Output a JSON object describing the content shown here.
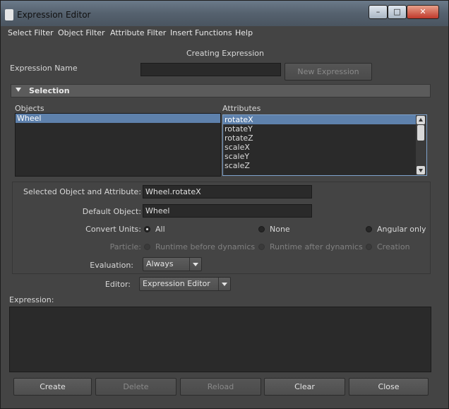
{
  "window": {
    "title": "Expression Editor",
    "controls": {
      "minimize": "–",
      "maximize": "□",
      "close": "✕"
    }
  },
  "menubar": {
    "items": [
      "Select Filter",
      "Object Filter",
      "Attribute Filter",
      "Insert Functions",
      "Help"
    ]
  },
  "status": "Creating Expression",
  "expression_name": {
    "label": "Expression Name",
    "value": "",
    "button": "New Expression"
  },
  "selection": {
    "title": "Selection",
    "objects_label": "Objects",
    "attributes_label": "Attributes",
    "objects": [
      "Wheel"
    ],
    "attributes": [
      "rotateX",
      "rotateY",
      "rotateZ",
      "scaleX",
      "scaleY",
      "scaleZ"
    ],
    "selected_object": "Wheel",
    "selected_attribute": "rotateX"
  },
  "fields": {
    "selected_label": "Selected Object and Attribute:",
    "selected_value": "Wheel.rotateX",
    "default_label": "Default Object:",
    "default_value": "Wheel"
  },
  "convert_units": {
    "label": "Convert Units:",
    "options": [
      "All",
      "None",
      "Angular only"
    ],
    "selected": "All"
  },
  "particle": {
    "label": "Particle:",
    "options": [
      "Runtime before dynamics",
      "Runtime after dynamics",
      "Creation"
    ],
    "enabled": false
  },
  "evaluation": {
    "label": "Evaluation:",
    "value": "Always"
  },
  "editor": {
    "label": "Editor:",
    "value": "Expression Editor"
  },
  "expression": {
    "label": "Expression:",
    "text": ""
  },
  "buttons": {
    "create": "Create",
    "delete": "Delete",
    "reload": "Reload",
    "clear": "Clear",
    "close": "Close"
  },
  "colors": {
    "background": "#444444",
    "selection": "#5e81ac",
    "field": "#2a2a2a"
  }
}
